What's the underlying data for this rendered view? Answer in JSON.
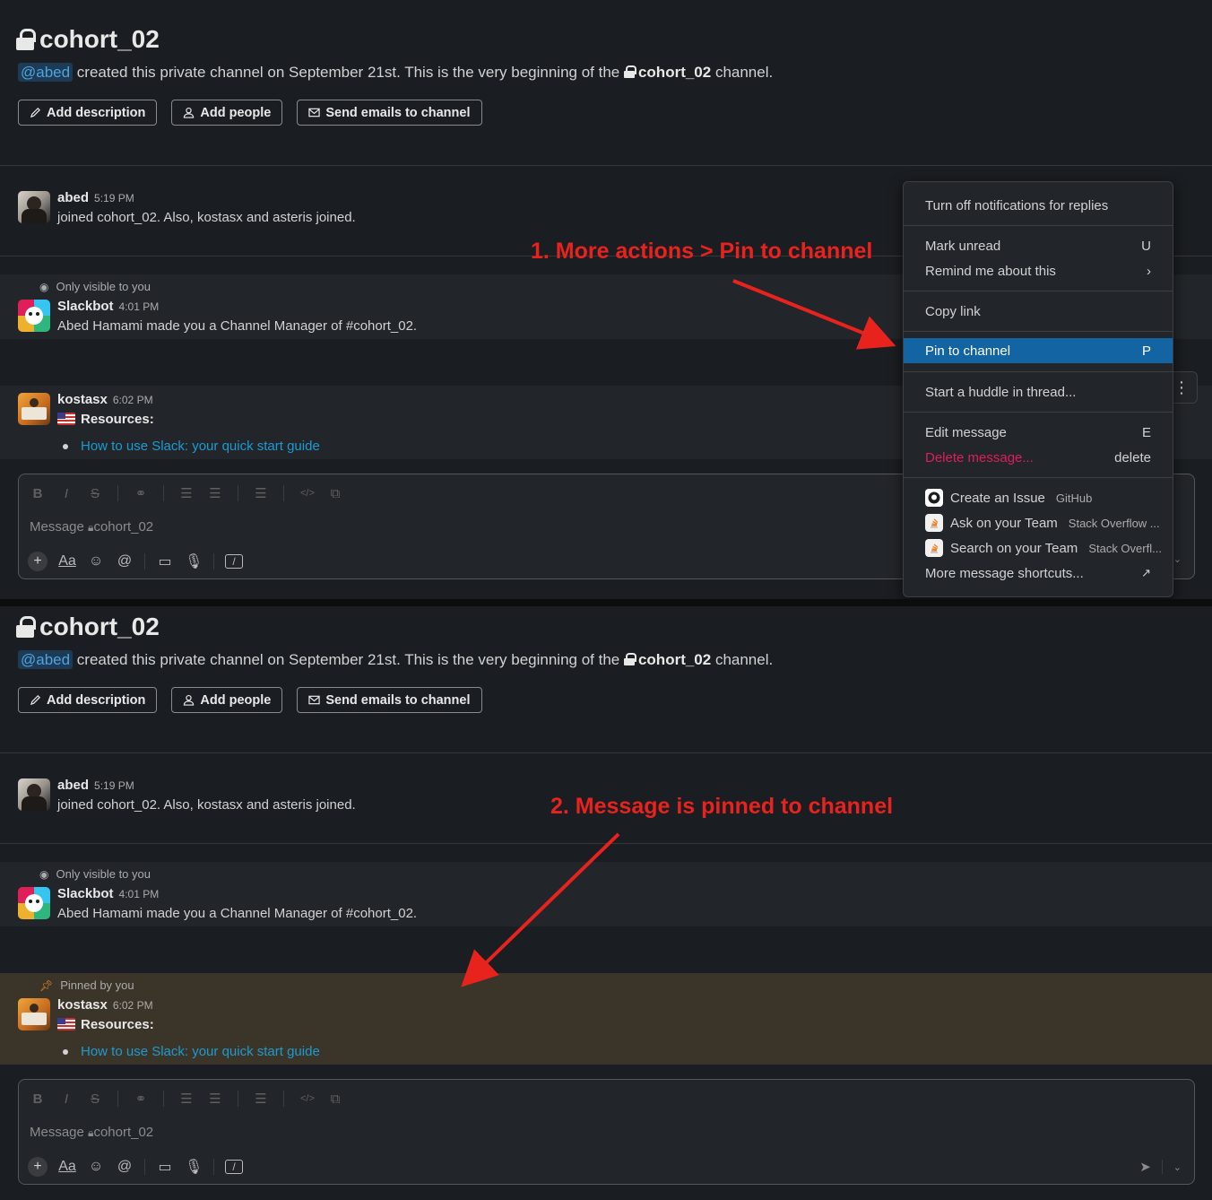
{
  "channel": {
    "name": "cohort_02",
    "intro_mention": "@abed",
    "intro_text": " created this private channel on September 21st. This is the very beginning of the ",
    "intro_channel": "cohort_02",
    "intro_tail": " channel."
  },
  "actions": {
    "add_description": "Add description",
    "add_people": "Add people",
    "send_emails": "Send emails to channel"
  },
  "messages": {
    "abed": {
      "name": "abed",
      "time": "5:19 PM",
      "text": "joined cohort_02. Also, kostasx and asteris joined."
    },
    "slackbot": {
      "note": "Only visible to you",
      "name": "Slackbot",
      "time": "4:01 PM",
      "text": "Abed Hamami made you a Channel Manager of #cohort_02."
    },
    "kostasx": {
      "name": "kostasx",
      "time": "6:02 PM",
      "text": "Resources:",
      "link": "How to use Slack: your quick start guide"
    },
    "pinned_note": "Pinned by you"
  },
  "composer": {
    "placeholder_prefix": "Message ",
    "placeholder_channel": "cohort_02",
    "aa": "Aa"
  },
  "menu": {
    "turn_off": "Turn off notifications for replies",
    "mark_unread": "Mark unread",
    "mark_unread_key": "U",
    "remind": "Remind me about this",
    "remind_key": "›",
    "copy_link": "Copy link",
    "pin": "Pin to channel",
    "pin_key": "P",
    "huddle": "Start a huddle in thread...",
    "edit": "Edit message",
    "edit_key": "E",
    "delete": "Delete message...",
    "delete_key": "delete",
    "create_issue": "Create an Issue",
    "create_issue_app": "GitHub",
    "ask_team": "Ask on your Team",
    "ask_team_app": "Stack Overflow ...",
    "search_team": "Search on your Team",
    "search_team_app": "Stack Overfl...",
    "more_shortcuts": "More message shortcuts..."
  },
  "annotations": {
    "step1": "1. More actions > Pin to channel",
    "step2": "2. Message is pinned to channel"
  },
  "colors": {
    "background": "#1a1d21",
    "menu_active": "#1264a3",
    "pinned_bg": "#3b3428",
    "annotation": "#e8231e",
    "link": "#1d9bd1",
    "danger": "#e01e5a"
  }
}
